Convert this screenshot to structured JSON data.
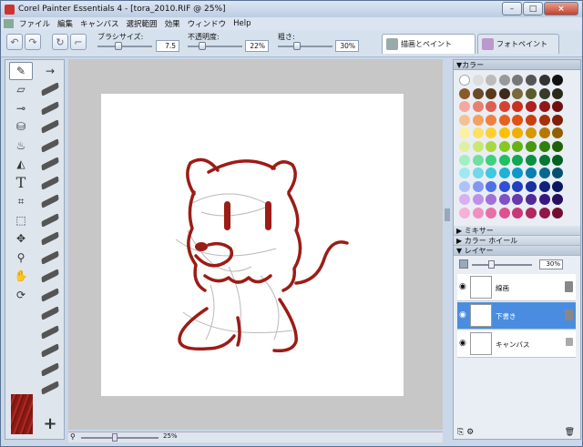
{
  "window": {
    "title": "Corel Painter Essentials 4 - [tora_2010.RIF @ 25%]"
  },
  "menu": [
    "ファイル",
    "編集",
    "キャンバス",
    "選択範囲",
    "効果",
    "ウィンドウ",
    "Help"
  ],
  "props": {
    "size_label": "ブラシサイズ:",
    "size_value": "7.5",
    "opacity_label": "不透明度:",
    "opacity_value": "22%",
    "grain_label": "粗さ:",
    "grain_value": "30%"
  },
  "tabs": {
    "paint": "描画とペイント",
    "photo": "フォトペイント"
  },
  "status": {
    "zoom": "25%"
  },
  "panels": {
    "color": "▼カラー",
    "mixer": "▶ ミキサー",
    "wheel": "▶ カラー ホイール",
    "layers": "▼ レイヤー",
    "layer_opacity": "30%"
  },
  "layers": [
    {
      "name": "線画"
    },
    {
      "name": "下書き"
    },
    {
      "name": "キャンバス"
    }
  ],
  "colors": {
    "accent": "#4a8de0",
    "stroke": "#9c1c16"
  }
}
